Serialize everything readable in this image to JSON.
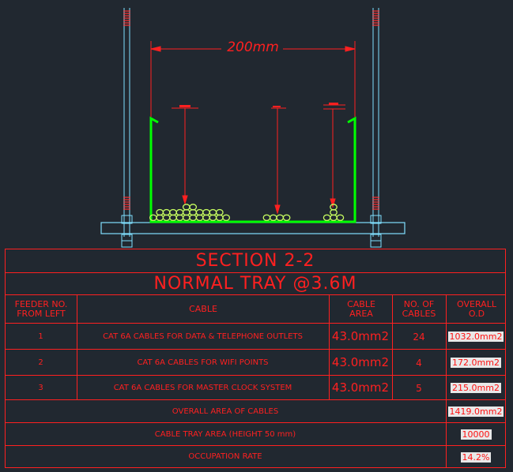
{
  "drawing": {
    "dimension_label": "200mm"
  },
  "schedule": {
    "section_title": "SECTION 2-2",
    "tray_title": "NORMAL TRAY @3.6M",
    "headers": {
      "feeder": "FEEDER NO. FROM LEFT",
      "cable": "CABLE",
      "cable_area": "CABLE AREA",
      "no_of_cables": "NO. OF CABLES",
      "overall_od": "OVERALL O.D"
    },
    "rows": [
      {
        "feeder": "1",
        "cable": "CAT 6A CABLES FOR DATA & TELEPHONE OUTLETS",
        "area": "43.0mm2",
        "count": "24",
        "od": "1032.0mm2"
      },
      {
        "feeder": "2",
        "cable": "CAT 6A CABLES FOR WIFI POINTS",
        "area": "43.0mm2",
        "count": "4",
        "od": "172.0mm2"
      },
      {
        "feeder": "3",
        "cable": "CAT 6A CABLES FOR MASTER CLOCK SYSTEM",
        "area": "43.0mm2",
        "count": "5",
        "od": "215.0mm2"
      }
    ],
    "summary": [
      {
        "label": "OVERALL AREA OF CABLES",
        "value": "1419.0mm2"
      },
      {
        "label": "CABLE TRAY AREA (HEIGHT 50 mm)",
        "value": "10000"
      },
      {
        "label": "OCCUPATION RATE",
        "value": "14.2%"
      }
    ]
  },
  "colors": {
    "background": "#212830",
    "table_lines": "#ff2020",
    "tray": "#00ff00",
    "support": "#80e0ff",
    "cable": "#c8ff60"
  }
}
